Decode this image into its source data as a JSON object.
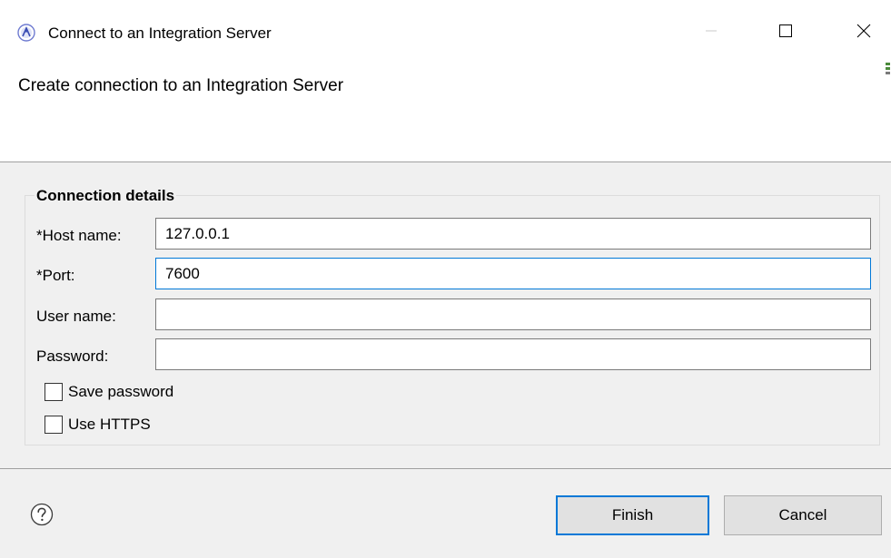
{
  "window": {
    "title": "Connect to an Integration Server",
    "app_icon": "integration-server-icon",
    "controls": {
      "minimize_icon": "minimize-icon",
      "maximize_icon": "maximize-icon",
      "close_icon": "close-icon"
    }
  },
  "header": {
    "title": "Create connection to an Integration Server"
  },
  "form": {
    "group_label": "Connection details",
    "fields": {
      "host": {
        "label": "*Host name:",
        "value": "127.0.0.1"
      },
      "port": {
        "label": "*Port:",
        "value": "7600"
      },
      "user": {
        "label": "User name:",
        "value": ""
      },
      "password": {
        "label": "Password:",
        "value": ""
      }
    },
    "checkboxes": {
      "save_password": {
        "label": "Save password",
        "checked": false
      },
      "use_https": {
        "label": "Use HTTPS",
        "checked": false
      }
    }
  },
  "footer": {
    "help_icon": "help-icon",
    "finish_label": "Finish",
    "cancel_label": "Cancel"
  },
  "colors": {
    "focus_accent": "#0078d7",
    "content_bg": "#f0f0f0",
    "button_bg": "#e1e1e1"
  }
}
